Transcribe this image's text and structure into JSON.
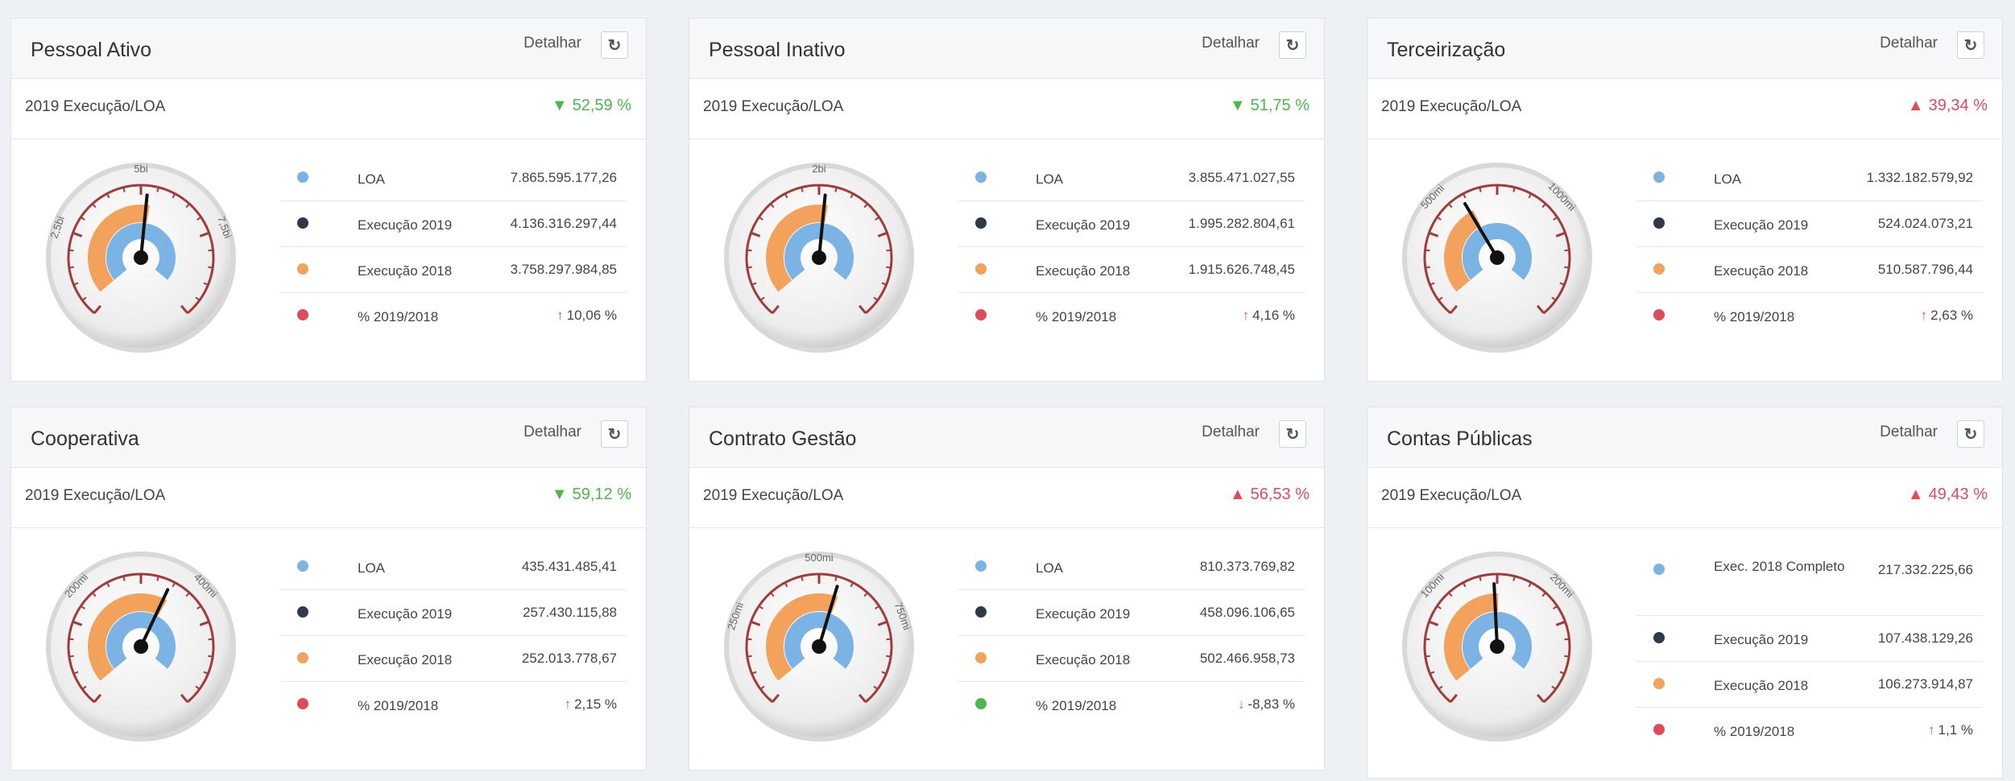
{
  "colors": {
    "loa": "#7ab3e4",
    "exec2019": "#2f3a48",
    "exec2018": "#f3a25c",
    "pct_up": "#e04b5a",
    "pct_down": "#4ab84a",
    "positive": "#4ab84a",
    "negative": "#e04b5a"
  },
  "common": {
    "detalhar": "Detalhar",
    "refresh_icon": "↻"
  },
  "cards": [
    {
      "title": "Pessoal Ativo",
      "sub_label": "2019 Execução/LOA",
      "pct_value": "52,59 %",
      "pct_dir": "down",
      "gauge_labels": [
        "2,5bi",
        "5bi",
        "7,5bi"
      ],
      "needle_fraction": 0.52,
      "rows": [
        {
          "label": "LOA",
          "value": "7.865.595.177,26",
          "dot": "loa"
        },
        {
          "label": "Execução 2019",
          "value": "4.136.316.297,44",
          "dot": "exec2019"
        },
        {
          "label": "Execução 2018",
          "value": "3.758.297.984,85",
          "dot": "exec2018"
        },
        {
          "label": "% 2019/2018",
          "value": "10,06 %",
          "dot": "pct_up",
          "arrow": "up"
        }
      ]
    },
    {
      "title": "Pessoal Inativo",
      "sub_label": "2019 Execução/LOA",
      "pct_value": "51,75 %",
      "pct_dir": "down",
      "gauge_labels": [
        "2bi"
      ],
      "needle_fraction": 0.52,
      "rows": [
        {
          "label": "LOA",
          "value": "3.855.471.027,55",
          "dot": "loa"
        },
        {
          "label": "Execução 2019",
          "value": "1.995.282.804,61",
          "dot": "exec2019"
        },
        {
          "label": "Execução 2018",
          "value": "1.915.626.748,45",
          "dot": "exec2018"
        },
        {
          "label": "% 2019/2018",
          "value": "4,16 %",
          "dot": "pct_up",
          "arrow": "up"
        }
      ]
    },
    {
      "title": "Terceirização",
      "sub_label": "2019 Execução/LOA",
      "pct_value": "39,34 %",
      "pct_dir": "up",
      "gauge_labels": [
        "500mi",
        "1000mi"
      ],
      "needle_fraction": 0.39,
      "rows": [
        {
          "label": "LOA",
          "value": "1.332.182.579,92",
          "dot": "loa"
        },
        {
          "label": "Execução 2019",
          "value": "524.024.073,21",
          "dot": "exec2019"
        },
        {
          "label": "Execução 2018",
          "value": "510.587.796,44",
          "dot": "exec2018"
        },
        {
          "label": "% 2019/2018",
          "value": "2,63 %",
          "dot": "pct_up",
          "arrow": "up"
        }
      ]
    },
    {
      "title": "Cooperativa",
      "sub_label": "2019 Execução/LOA",
      "pct_value": "59,12 %",
      "pct_dir": "down",
      "gauge_labels": [
        "200mi",
        "400mi"
      ],
      "needle_fraction": 0.59,
      "rows": [
        {
          "label": "LOA",
          "value": "435.431.485,41",
          "dot": "loa"
        },
        {
          "label": "Execução 2019",
          "value": "257.430.115,88",
          "dot": "exec2019"
        },
        {
          "label": "Execução 2018",
          "value": "252.013.778,67",
          "dot": "exec2018"
        },
        {
          "label": "% 2019/2018",
          "value": "2,15 %",
          "dot": "pct_up",
          "arrow": "up"
        }
      ]
    },
    {
      "title": "Contrato Gestão",
      "sub_label": "2019 Execução/LOA",
      "pct_value": "56,53 %",
      "pct_dir": "up",
      "gauge_labels": [
        "250mi",
        "500mi",
        "750mi"
      ],
      "needle_fraction": 0.56,
      "rows": [
        {
          "label": "LOA",
          "value": "810.373.769,82",
          "dot": "loa"
        },
        {
          "label": "Execução 2019",
          "value": "458.096.106,65",
          "dot": "exec2019"
        },
        {
          "label": "Execução 2018",
          "value": "502.466.958,73",
          "dot": "exec2018"
        },
        {
          "label": "% 2019/2018",
          "value": "-8,83 %",
          "dot": "pct_down",
          "arrow": "down"
        }
      ]
    },
    {
      "title": "Contas Públicas",
      "sub_label": "2019 Execução/LOA",
      "pct_value": "49,43 %",
      "pct_dir": "up",
      "gauge_labels": [
        "100mi",
        "200mi"
      ],
      "needle_fraction": 0.49,
      "rows": [
        {
          "label": "Exec. 2018 Completo",
          "value": "217.332.225,66",
          "dot": "loa",
          "tall": true
        },
        {
          "label": "Execução 2019",
          "value": "107.438.129,26",
          "dot": "exec2019"
        },
        {
          "label": "Execução 2018",
          "value": "106.273.914,87",
          "dot": "exec2018"
        },
        {
          "label": "% 2019/2018",
          "value": "1,1 %",
          "dot": "pct_up",
          "arrow": "up"
        }
      ]
    }
  ]
}
